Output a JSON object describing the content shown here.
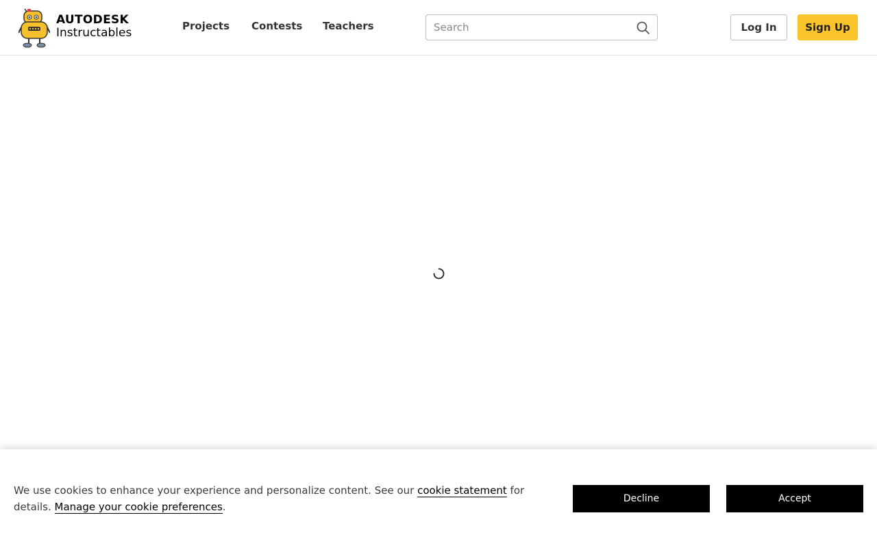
{
  "header": {
    "brand": {
      "line1": "AUTODESK",
      "line2": "Instructables"
    },
    "nav": [
      {
        "label": "Projects"
      },
      {
        "label": "Contests"
      },
      {
        "label": "Teachers"
      }
    ],
    "search": {
      "placeholder": "Search",
      "value": ""
    },
    "login_label": "Log In",
    "signup_label": "Sign Up"
  },
  "main": {
    "loading_icon": "loading-spinner-icon"
  },
  "cookie_banner": {
    "text_before_link": "We use cookies to enhance your experience and personalize content. See our ",
    "cookie_statement_link": "cookie statement",
    "text_after_link": " for details. ",
    "manage_link": "Manage your cookie preferences",
    "period": ".",
    "decline_label": "Decline",
    "accept_label": "Accept"
  },
  "colors": {
    "accent_yellow": "#fac42a",
    "button_black": "#000000",
    "text_dark": "#333333"
  },
  "icons": {
    "logo": "instructables-robot-logo",
    "search": "search-icon",
    "spinner": "loading-spinner-icon"
  }
}
